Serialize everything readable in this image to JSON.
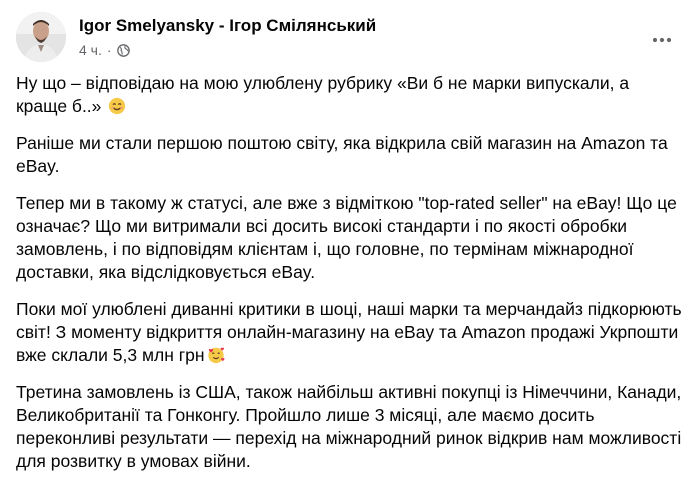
{
  "post": {
    "author": "Igor Smelyansky - Ігор Смілянський",
    "time": "4 ч.",
    "separator": "·",
    "icons": {
      "audience": "globe-icon",
      "more": "more-options-icon",
      "avatar": "avatar"
    },
    "paragraphs": [
      {
        "text": "Ну що – відповідаю на мою улюблену рубрику «Ви б не марки випускали, а краще б..»",
        "emoji": "smiling-face-emoji"
      },
      {
        "text": "Раніше ми стали першою поштою світу, яка відкрила свій магазин на Amazon та eBay."
      },
      {
        "text": "Тепер ми в такому ж статусі, але вже з відміткою \"top-rated seller\" на eBay! Що це означає? Що ми витримали всі досить високі стандарти і по якості обробки замовлень, і по відповідям клієнтам і, що головне, по термінам міжнародної доставки, яка відслідковується eBay."
      },
      {
        "text": "Поки мої улюблені диванні критики в шоці, наші марки та мерчандайз підкорюють світ! З моменту відкриття онлайн-магазину на eBay та Amazon продажі Укрпошти вже склали 5,3 млн грн",
        "emoji": "smiling-face-with-hearts-emoji"
      },
      {
        "text": "Третина замовлень із США, також найбільш активні покупці із Німеччини, Канади, Великобританії та Гонконгу. Пройшло лише 3 місяці, але маємо досить переконливі результати — перехід на міжнародний ринок відкрив нам можливості для розвитку в умовах війни."
      }
    ]
  }
}
